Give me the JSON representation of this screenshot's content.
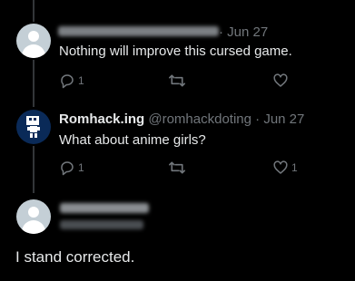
{
  "tweets": [
    {
      "author_name": "",
      "handle": "",
      "date": "· Jun 27",
      "text": "Nothing will improve this cursed game.",
      "stats": {
        "replies": "1",
        "retweets": "",
        "likes": ""
      }
    },
    {
      "author_name": "Romhack.ing",
      "handle": "@romhackdoting",
      "date": "· Jun 27",
      "text": "What about anime girls?",
      "stats": {
        "replies": "1",
        "retweets": "",
        "likes": "1"
      }
    }
  ],
  "main_tweet": {
    "text": "I stand corrected."
  },
  "icons": {
    "reply": "reply-icon",
    "retweet": "retweet-icon",
    "like": "heart-icon"
  },
  "colors": {
    "background": "#000000",
    "text": "#e7e9ea",
    "muted": "#71767b",
    "avatar_default": "#c4cfd6"
  }
}
